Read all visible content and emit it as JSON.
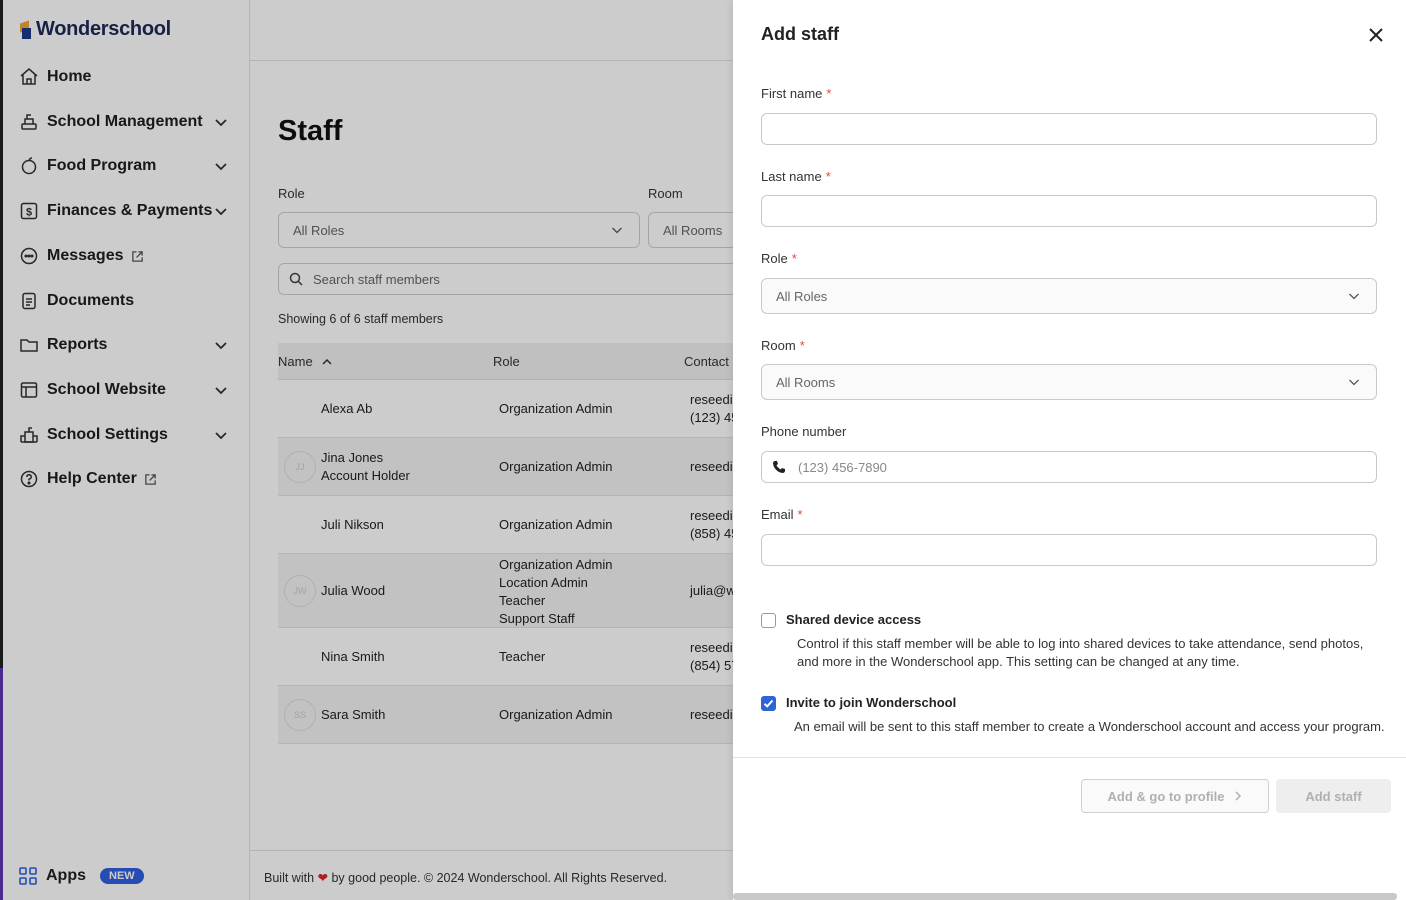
{
  "brand": {
    "name": "Wonderschool"
  },
  "sidebar": {
    "items": [
      {
        "label": "Home"
      },
      {
        "label": "School Management"
      },
      {
        "label": "Food Program"
      },
      {
        "label": "Finances & Payments"
      },
      {
        "label": "Messages"
      },
      {
        "label": "Documents"
      },
      {
        "label": "Reports"
      },
      {
        "label": "School Website"
      },
      {
        "label": "School Settings"
      },
      {
        "label": "Help Center"
      }
    ],
    "apps_label": "Apps",
    "apps_badge": "NEW"
  },
  "main": {
    "title": "Staff",
    "role_label": "Role",
    "role_value": "All Roles",
    "room_label": "Room",
    "room_value": "All Rooms",
    "search_placeholder": "Search staff members",
    "showing": "Showing 6 of 6 staff members",
    "columns": {
      "name": "Name",
      "role": "Role",
      "contact": "Contact"
    },
    "rows": [
      {
        "initials": "",
        "name": "Alexa Ab",
        "sub": "",
        "roles": [
          "Organization Admin"
        ],
        "contact": [
          "reseedi",
          "(123) 45"
        ]
      },
      {
        "initials": "JJ",
        "name": "Jina Jones",
        "sub": "Account Holder",
        "roles": [
          "Organization Admin"
        ],
        "contact": [
          "reseedi"
        ]
      },
      {
        "initials": "",
        "name": "Juli Nikson",
        "sub": "",
        "roles": [
          "Organization Admin"
        ],
        "contact": [
          "reseedi",
          "(858) 45"
        ]
      },
      {
        "initials": "JW",
        "name": "Julia Wood",
        "sub": "",
        "roles": [
          "Organization Admin",
          "Location Admin",
          "Teacher",
          "Support Staff"
        ],
        "contact": [
          "julia@w"
        ]
      },
      {
        "initials": "",
        "name": "Nina Smith",
        "sub": "",
        "roles": [
          "Teacher"
        ],
        "contact": [
          "reseedi",
          "(854) 57"
        ]
      },
      {
        "initials": "SS",
        "name": "Sara Smith",
        "sub": "",
        "roles": [
          "Organization Admin"
        ],
        "contact": [
          "reseedi"
        ]
      }
    ],
    "footer_pre": "Built with",
    "footer_post": "by good people. © 2024 Wonderschool. All Rights Reserved."
  },
  "drawer": {
    "title": "Add staff",
    "first_name_label": "First name",
    "last_name_label": "Last name",
    "role_label": "Role",
    "role_value": "All Roles",
    "room_label": "Room",
    "room_value": "All Rooms",
    "phone_label": "Phone number",
    "phone_placeholder": "(123) 456-7890",
    "email_label": "Email",
    "required_mark": "*",
    "shared_label": "Shared device access",
    "shared_checked": false,
    "shared_desc_1": "Control if this staff member will be able to log into shared devices to take attendance, send photos,",
    "shared_desc_2": "and more in the Wonderschool app. This setting can be changed at any time.",
    "invite_label": "Invite to join Wonderschool",
    "invite_checked": true,
    "invite_desc": "An email will be sent to this staff member to create a Wonderschool account and access your program.",
    "btn_profile": "Add & go to profile",
    "btn_add": "Add staff"
  },
  "colors": {
    "accent": "#2f64d6",
    "required": "#e04a3a",
    "badge": "#2f5fe0",
    "brand_text": "#1d2a57"
  }
}
